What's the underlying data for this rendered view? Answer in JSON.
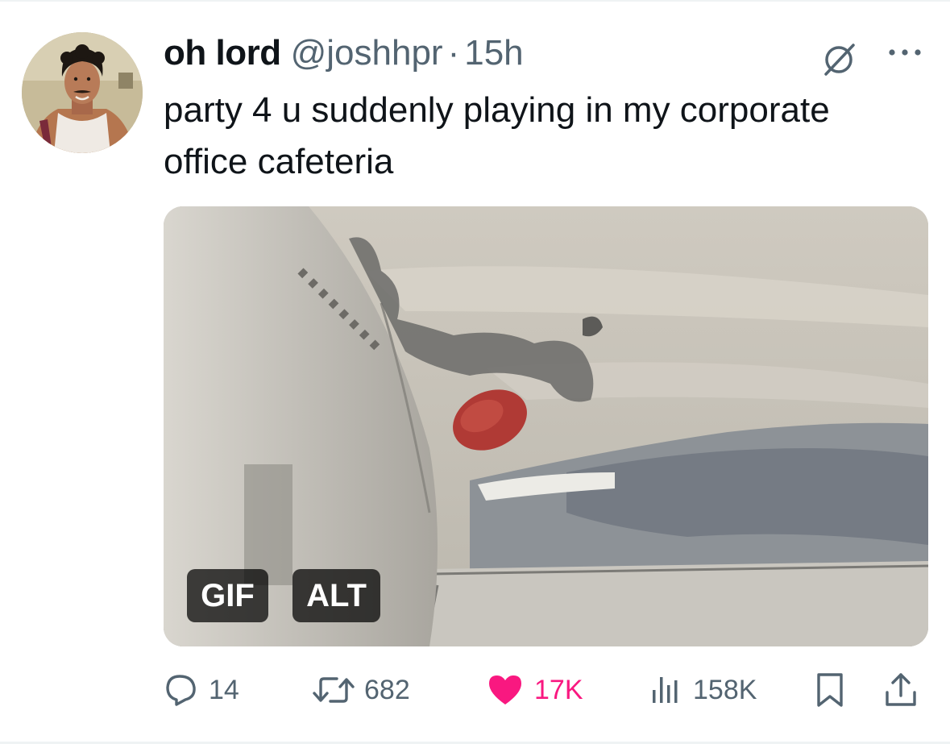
{
  "tweet": {
    "display_name": "oh lord",
    "handle": "@joshhpr",
    "separator": "·",
    "time": "15h",
    "text": "party 4 u suddenly playing in my corporate office cafeteria"
  },
  "media": {
    "badges": {
      "gif": "GIF",
      "alt": "ALT"
    }
  },
  "actions": {
    "replies": "14",
    "reposts": "682",
    "likes": "17K",
    "views": "158K"
  },
  "icons": {
    "header": [
      "grok-icon",
      "more-icon"
    ],
    "actions": [
      "reply-icon",
      "repost-icon",
      "like-icon",
      "views-icon",
      "bookmark-icon",
      "share-icon"
    ]
  },
  "colors": {
    "text_primary": "#0f1419",
    "text_secondary": "#536471",
    "like": "#f91880",
    "badge_bg": "#000000"
  }
}
